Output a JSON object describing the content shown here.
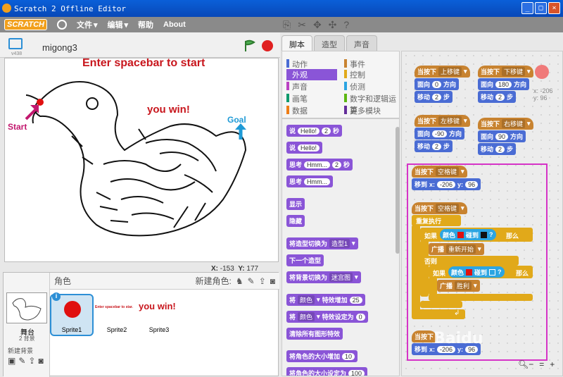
{
  "window": {
    "title": "Scratch 2 Offline Editor",
    "buttons": [
      "_",
      "□",
      "×"
    ]
  },
  "menu": {
    "logo": "SCRATCH",
    "items": [
      "文件",
      "编辑",
      "帮助",
      "About"
    ]
  },
  "stage": {
    "project_name": "migong3",
    "version": "v438",
    "texts": {
      "title": "Enter spacebar to start",
      "win": "you win!",
      "start": "Start",
      "goal": "Goal"
    },
    "coords": {
      "x_label": "X:",
      "x": "-153",
      "y_label": "Y:",
      "y": "177"
    }
  },
  "sprite_pane": {
    "header": "角色",
    "new_sprite": "新建角色:",
    "stage_label": "舞台",
    "stage_bg_count": "2 背景",
    "new_backdrop": "新建背景",
    "sprites": [
      "Sprite1",
      "Sprite2",
      "Sprite3"
    ],
    "sprite2_text": "Enter spacebar to star.",
    "sprite3_text": "you win!"
  },
  "tabs": [
    "脚本",
    "造型",
    "声音"
  ],
  "categories": {
    "left": [
      {
        "label": "动作",
        "color": "#4a6cd4"
      },
      {
        "label": "外观",
        "color": "#8a55d7"
      },
      {
        "label": "声音",
        "color": "#bb42c3"
      },
      {
        "label": "画笔",
        "color": "#0e9a6c"
      },
      {
        "label": "数据",
        "color": "#ee7d16"
      }
    ],
    "right": [
      {
        "label": "事件",
        "color": "#c88330"
      },
      {
        "label": "控制",
        "color": "#e1a91a"
      },
      {
        "label": "侦测",
        "color": "#2ca5e2"
      },
      {
        "label": "数字和逻辑运算",
        "color": "#5cb712"
      },
      {
        "label": "更多模块",
        "color": "#632d99"
      }
    ]
  },
  "palette": {
    "say": "说",
    "hello": "Hello!",
    "secs": "秒",
    "two": "2",
    "think": "思考",
    "hmm": "Hmm...",
    "show": "显示",
    "hide": "隐藏",
    "switch_costume": "将造型切换为",
    "costume_opt": "造型1",
    "next_costume": "下一个造型",
    "switch_bg": "将背景切换为",
    "bg_opt": "迷宫图",
    "effect": "将",
    "effect_opt": "颜色",
    "effect_inc": "特效增加",
    "effect_inc_val": "25",
    "effect_set": "特效设定为",
    "effect_set_val": "0",
    "clear_effects": "清除所有图形特效",
    "size_inc": "将角色的大小增加",
    "size_inc_val": "10",
    "size_set": "将角色的大小设定为",
    "size_set_val": "100"
  },
  "scripts": {
    "when_pressed": "当按下",
    "up": "上移键",
    "down": "下移键",
    "left": "左移键",
    "right": "右移键",
    "space": "空格键",
    "point": "面向",
    "direction": "方向",
    "move": "移动",
    "steps": "步",
    "dir_0": "0",
    "dir_180": "180",
    "dir_n90": "-90",
    "dir_90": "90",
    "step2": "2",
    "goto": "移到",
    "x": "x:",
    "y": "y:",
    "goto_x": "-206",
    "goto_y": "96",
    "forever": "重复执行",
    "if": "如果",
    "then": "那么",
    "color": "颜色",
    "touching": "碰到",
    "q": "?",
    "broadcast": "广播",
    "broadcast_opt1": "重新开始",
    "else": "否则",
    "broadcast_opt2": "胜利",
    "area_coord_x": "x: -206",
    "area_coord_y": "y: 96"
  },
  "watermark": "Baidu",
  "colors": {
    "titlebar": "#0a5fd8",
    "looks": "#8a55d7",
    "events": "#c88330",
    "motion": "#4a6cd4",
    "control": "#e1a91a",
    "highlight": "#d633c7"
  }
}
